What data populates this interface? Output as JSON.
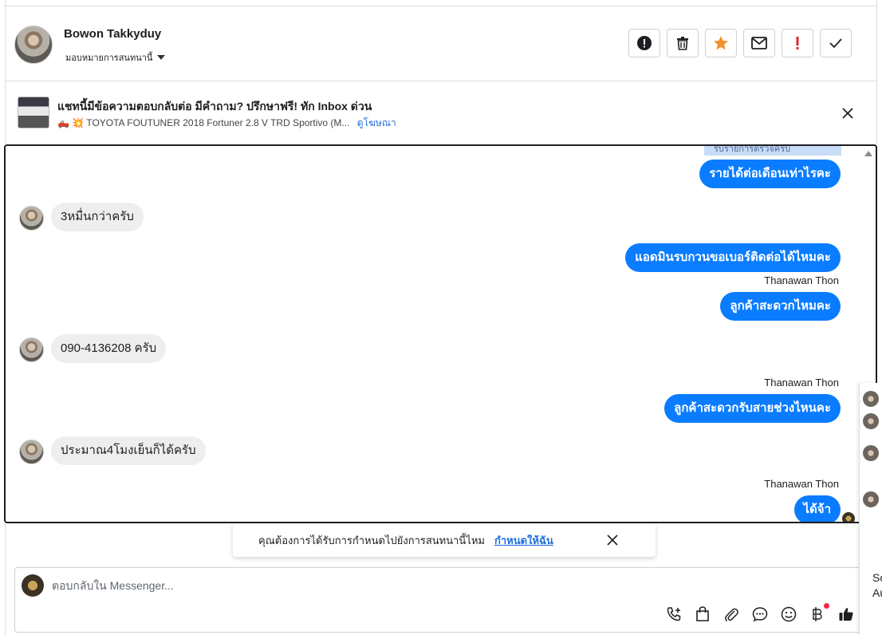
{
  "header": {
    "contact_name": "Bowon Takkyduy",
    "assign_label": "มอบหมายการสนทนานี้",
    "actions": [
      {
        "name": "spam-icon",
        "label": "!"
      },
      {
        "name": "trash-icon",
        "label": ""
      },
      {
        "name": "star-icon",
        "label": ""
      },
      {
        "name": "mail-icon",
        "label": ""
      },
      {
        "name": "important-icon",
        "label": "!"
      },
      {
        "name": "check-icon",
        "label": ""
      }
    ],
    "accent_star": "#f5902a",
    "accent_important": "#e02a2a"
  },
  "ad_banner": {
    "title": "แชทนี้มีข้อความตอบกลับต่อ มีคำถาม? ปรึกษาฟรี! ทัก Inbox ด่วน",
    "subtitle": "🛻 💥 TOYOTA FOUTUNER 2018 Fortuner 2.8 V TRD Sportivo (M...",
    "link": "ดูโฆษณา"
  },
  "chat": {
    "cut_off_text": "รบรายการตรวจครบ",
    "messages": [
      {
        "dir": "out",
        "text": "รายได้ต่อเดือนเท่าไรคะ"
      },
      {
        "dir": "in",
        "text": "3หมื่นกว่าครับ"
      },
      {
        "dir": "out",
        "text": "แอดมินรบกวนขอเบอร์ติดต่อได้ไหมคะ"
      },
      {
        "dir": "sender",
        "text": "Thanawan Thon"
      },
      {
        "dir": "out",
        "text": "ลูกค้าสะดวกไหมคะ"
      },
      {
        "dir": "in",
        "text": "090-4136208 ครับ"
      },
      {
        "dir": "sender",
        "text": "Thanawan Thon"
      },
      {
        "dir": "out",
        "text": "ลูกค้าสะดวกรับสายช่วงไหนคะ"
      },
      {
        "dir": "in",
        "text": "ประมาณ4โมงเย็นก็ได้ครับ"
      },
      {
        "dir": "sender",
        "text": "Thanawan Thon"
      },
      {
        "dir": "out",
        "text": "ได้จ้า"
      }
    ],
    "bubble_color": "#0a7cff",
    "incoming_color": "#eeeeee"
  },
  "assign_prompt": {
    "text": "คุณต้องการได้รับการกำหนดไปยังการสนทนานี้ไหม",
    "link": "กำหนดให้ฉัน"
  },
  "composer": {
    "placeholder": "ตอบกลับใน Messenger..."
  },
  "edge_panel": {
    "text_1": "Sc",
    "text_2": "Au"
  }
}
